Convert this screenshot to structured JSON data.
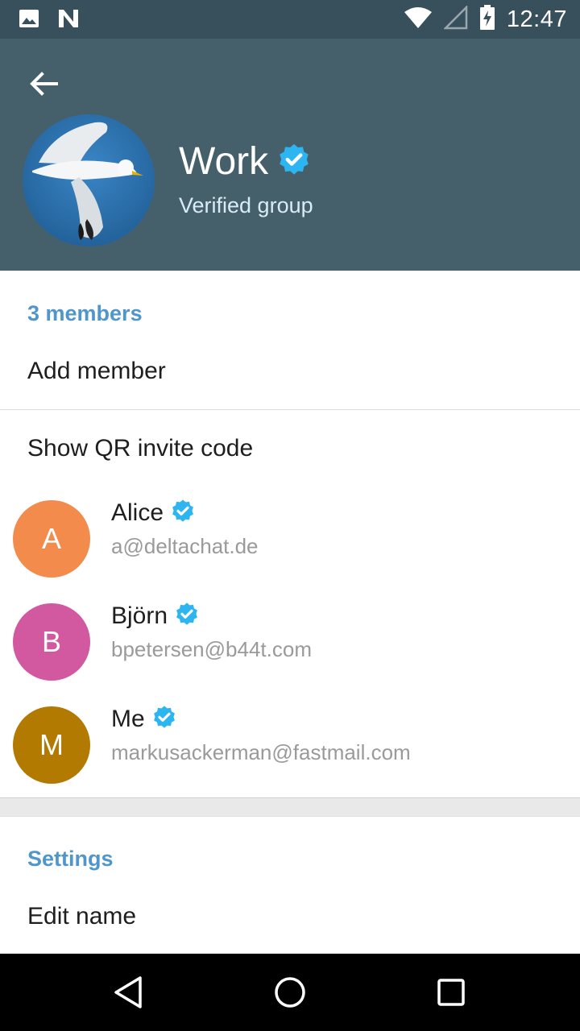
{
  "status_bar": {
    "time": "12:47",
    "icons": [
      "image-icon",
      "n-icon",
      "wifi-icon",
      "cell-signal-icon",
      "battery-charging-icon"
    ]
  },
  "header": {
    "back_icon": "arrow-left-icon",
    "title": "Work",
    "subtitle": "Verified group",
    "verified_badge_color": "#2db5f2",
    "background": "#455f6b"
  },
  "members_section": {
    "header": "3 members",
    "add_member": "Add member",
    "show_qr": "Show QR invite code",
    "members": [
      {
        "initial": "A",
        "name": "Alice",
        "email": "a@deltachat.de",
        "color": "#f28b4b"
      },
      {
        "initial": "B",
        "name": "Björn",
        "email": "bpetersen@b44t.com",
        "color": "#d2589f"
      },
      {
        "initial": "M",
        "name": "Me",
        "email": "markusackerman@fastmail.com",
        "color": "#b27a00"
      }
    ]
  },
  "settings_section": {
    "header": "Settings",
    "edit_name": "Edit name"
  },
  "nav_bar": {
    "icons": [
      "back-triangle-icon",
      "home-circle-icon",
      "recents-square-icon"
    ]
  }
}
